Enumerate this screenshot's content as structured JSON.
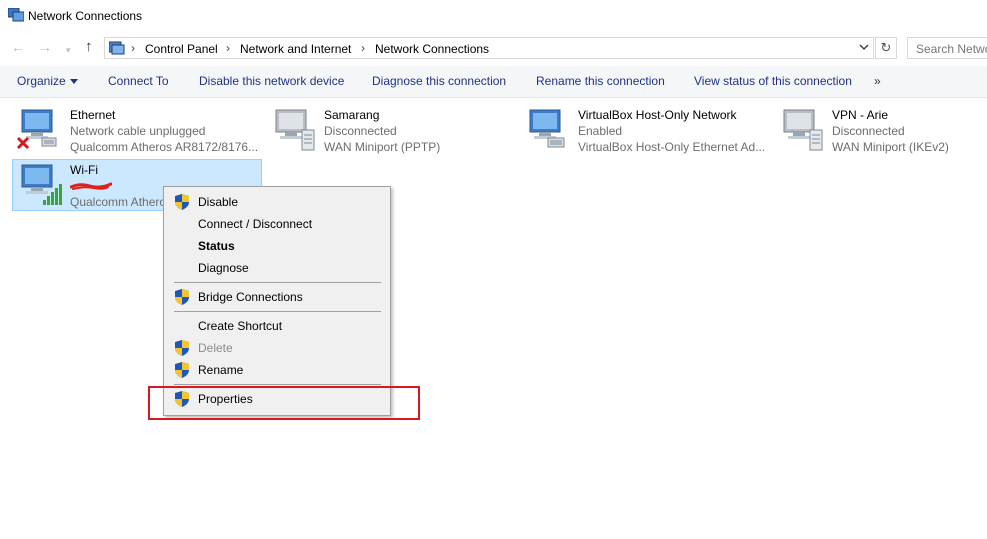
{
  "window": {
    "title": "Network Connections"
  },
  "nav": {
    "breadcrumbs": [
      "Control Panel",
      "Network and Internet",
      "Network Connections"
    ],
    "search_placeholder": "Search Netwo"
  },
  "commands": {
    "organize": "Organize",
    "connect_to": "Connect To",
    "disable_device": "Disable this network device",
    "diagnose": "Diagnose this connection",
    "rename": "Rename this connection",
    "view_status": "View status of this connection",
    "more": "»"
  },
  "connections": [
    {
      "name": "Ethernet",
      "status": "Network cable unplugged",
      "device": "Qualcomm Atheros AR8172/8176...",
      "icon": "ethernet-disconnected-icon"
    },
    {
      "name": "Samarang",
      "status": "Disconnected",
      "device": "WAN Miniport (PPTP)",
      "icon": "vpn-connection-icon"
    },
    {
      "name": "VirtualBox Host-Only Network",
      "status": "Enabled",
      "device": "VirtualBox Host-Only Ethernet Ad...",
      "icon": "ethernet-adapter-icon"
    },
    {
      "name": "VPN - Arie",
      "status": "Disconnected",
      "device": "WAN Miniport (IKEv2)",
      "icon": "vpn-connection-icon"
    },
    {
      "name": "Wi-Fi",
      "status": "",
      "device": "Qualcomm Atheros",
      "icon": "wifi-adapter-icon"
    }
  ],
  "context_menu": {
    "items": [
      {
        "label": "Disable",
        "shield": true,
        "style": "normal"
      },
      {
        "label": "Connect / Disconnect",
        "shield": false,
        "style": "normal"
      },
      {
        "label": "Status",
        "shield": false,
        "style": "bold"
      },
      {
        "label": "Diagnose",
        "shield": false,
        "style": "normal"
      },
      {
        "label": "Bridge Connections",
        "shield": true,
        "style": "normal"
      },
      {
        "label": "Create Shortcut",
        "shield": false,
        "style": "normal"
      },
      {
        "label": "Delete",
        "shield": true,
        "style": "disabled"
      },
      {
        "label": "Rename",
        "shield": true,
        "style": "normal"
      },
      {
        "label": "Properties",
        "shield": true,
        "style": "normal"
      }
    ]
  },
  "colors": {
    "command_text": "#1e3287",
    "selection": "#cce8ff",
    "highlight_box": "#d9191f"
  }
}
